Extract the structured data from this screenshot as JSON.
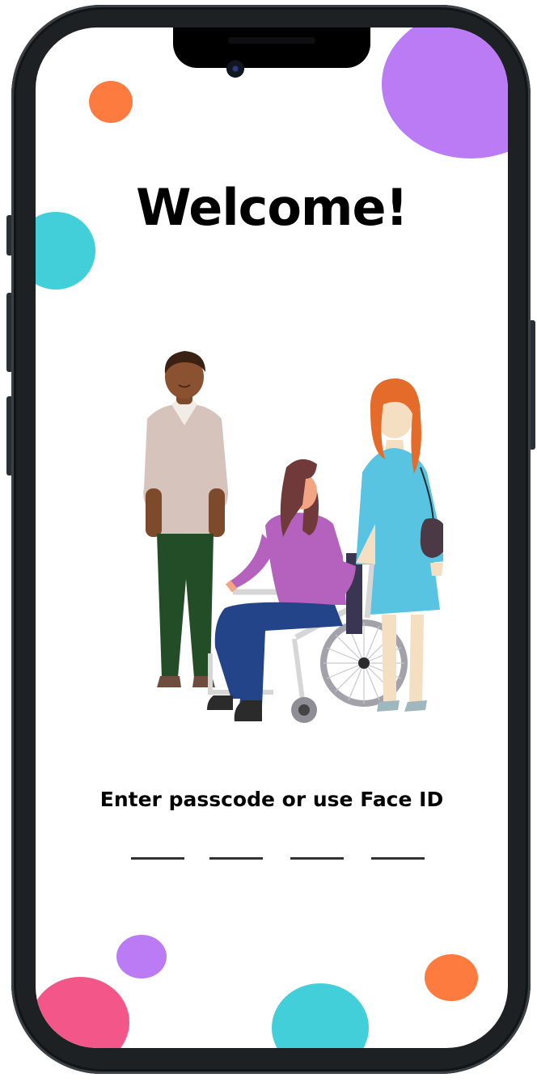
{
  "screen": {
    "title": "Welcome!",
    "prompt": "Enter passcode or use Face ID",
    "passcode_length": 4
  },
  "illustration": {
    "subject": "three-people-one-in-wheelchair"
  },
  "colors": {
    "purple": "#bb7bf5",
    "orange": "#fd7b3e",
    "teal": "#43cfd9",
    "pink": "#f3578a",
    "frame": "#1d2124"
  }
}
